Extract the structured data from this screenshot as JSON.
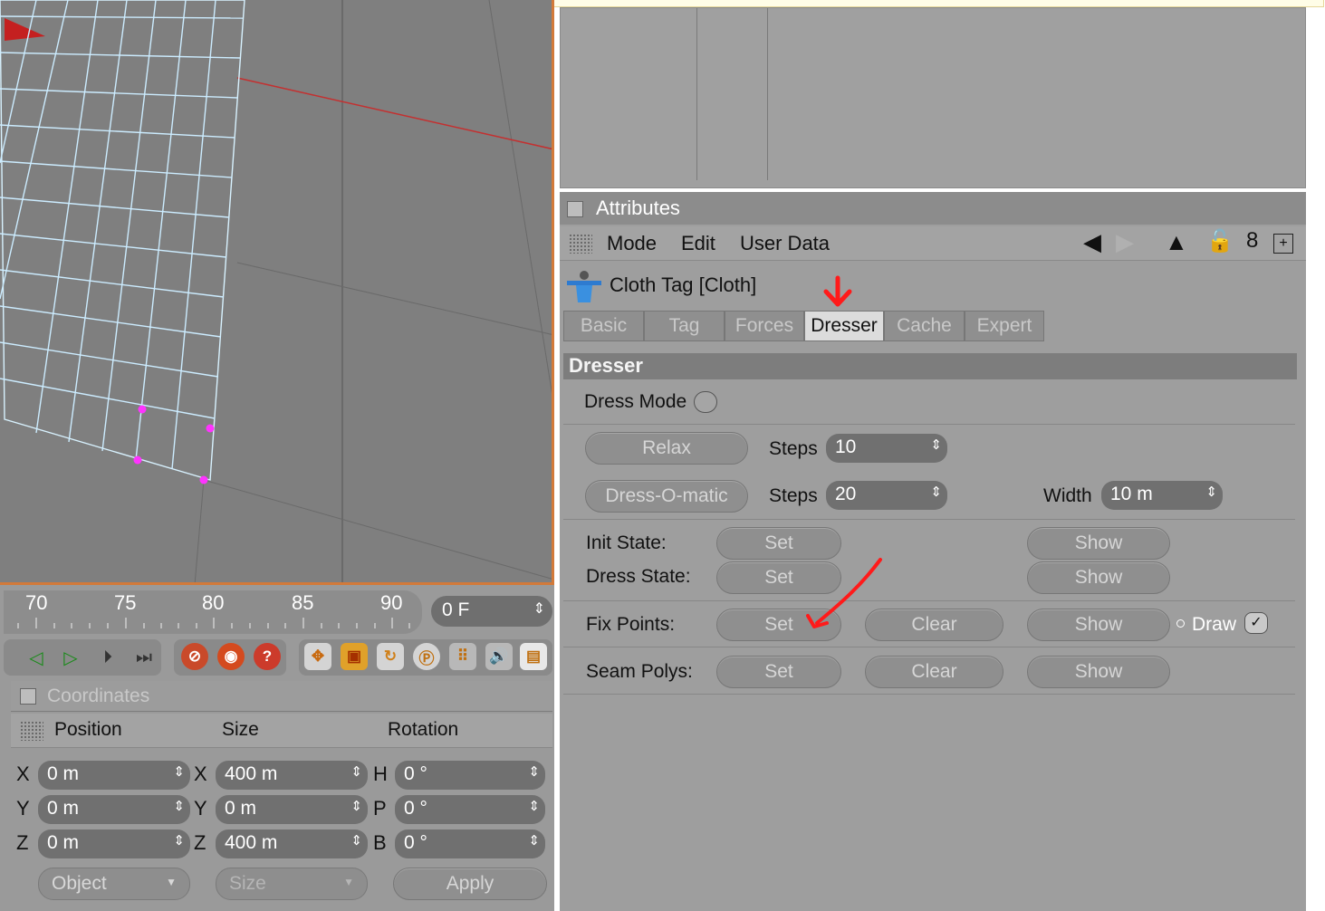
{
  "timeline": {
    "ticks": [
      "70",
      "75",
      "80",
      "85",
      "90"
    ],
    "current_frame": "0 F"
  },
  "coordinates": {
    "title": "Coordinates",
    "columns": [
      "Position",
      "Size",
      "Rotation"
    ],
    "rows": [
      {
        "pos_axis": "X",
        "pos": "0 m",
        "size_axis": "X",
        "size": "400 m",
        "rot_axis": "H",
        "rot": "0 °"
      },
      {
        "pos_axis": "Y",
        "pos": "0 m",
        "size_axis": "Y",
        "size": "0 m",
        "rot_axis": "P",
        "rot": "0 °"
      },
      {
        "pos_axis": "Z",
        "pos": "0 m",
        "size_axis": "Z",
        "size": "400 m",
        "rot_axis": "B",
        "rot": "0 °"
      }
    ],
    "mode_select": "Object",
    "size_select": "Size",
    "apply_label": "Apply"
  },
  "attributes": {
    "title": "Attributes",
    "menu": [
      "Mode",
      "Edit",
      "User Data"
    ],
    "tag_title": "Cloth Tag [Cloth]",
    "tabs": [
      "Basic",
      "Tag",
      "Forces",
      "Dresser",
      "Cache",
      "Expert"
    ],
    "active_tab": "Dresser",
    "section": "Dresser",
    "dress_mode_label": "Dress Mode",
    "relax_label": "Relax",
    "steps_label": "Steps",
    "relax_steps": "10",
    "dressomatic_label": "Dress-O-matic",
    "dressomatic_steps": "20",
    "width_label": "Width",
    "width_value": "10 m",
    "init_state_label": "Init State:",
    "dress_state_label": "Dress State:",
    "fix_points_label": "Fix Points:",
    "seam_polys_label": "Seam Polys:",
    "set_label": "Set",
    "clear_label": "Clear",
    "show_label": "Show",
    "draw_label": "Draw"
  },
  "colors": {
    "annotation": "#ff1a1a",
    "viewport_border": "#d27a3a",
    "fixed_point": "#ff33ff"
  }
}
